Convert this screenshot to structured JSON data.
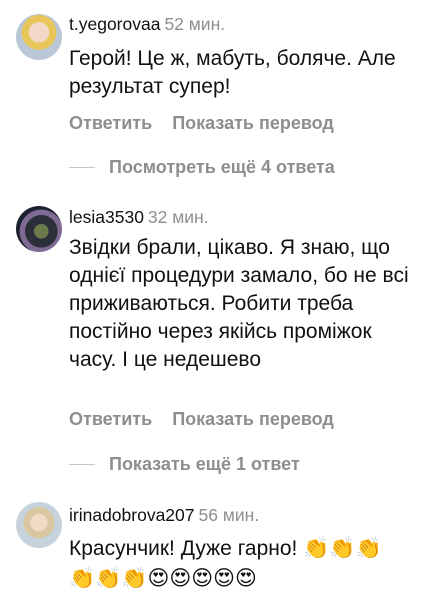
{
  "comments": [
    {
      "username": "t.yegorovaa",
      "time": "52 мин.",
      "text": "Герой! Це ж, мабуть, боляче. Але результат супер!",
      "reply": "Ответить",
      "translate": "Показать перевод"
    },
    {
      "username": "lesia3530",
      "time": "32 мин.",
      "text": "Звідки брали, цікаво. Я знаю, що однієї процедури замало, бо не всі приживаються. Робити треба постійно через якійсь проміжок часу. І це недешево",
      "reply": "Ответить",
      "translate": "Показать перевод"
    },
    {
      "username": "irinadobrova207",
      "time": "56 мин.",
      "text": "Красунчик! Дуже гарно! 👏👏👏👏👏👏😍😍😍😍😍"
    }
  ],
  "more_replies": [
    "Посмотреть ещё 4 ответа",
    "Показать ещё 1 ответ"
  ]
}
